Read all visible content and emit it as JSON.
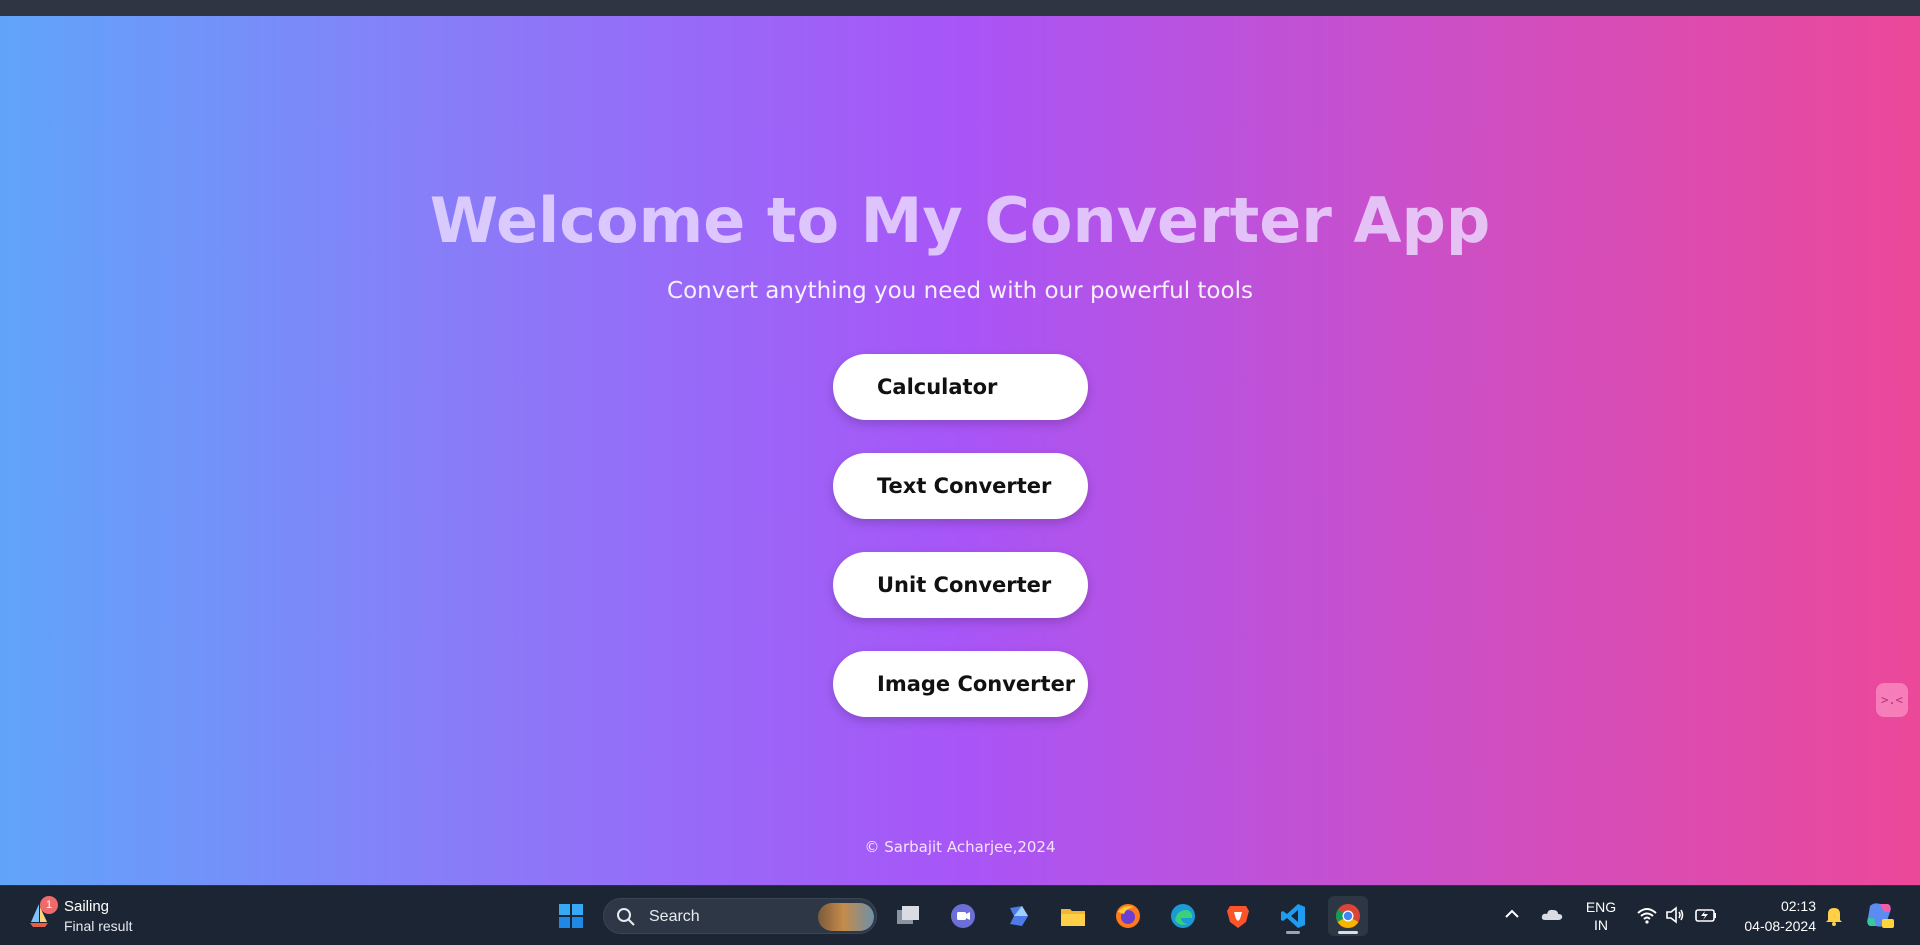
{
  "page": {
    "title": "Welcome to My Converter App",
    "subtitle": "Convert anything you need with our powerful tools",
    "buttons": [
      {
        "label": "Calculator"
      },
      {
        "label": "Text Converter"
      },
      {
        "label": "Unit Converter"
      },
      {
        "label": "Image Converter"
      }
    ],
    "footer": "© Sarbajit Acharjee,2024",
    "widget_glyph": ">.<",
    "gradient_colors": [
      "#60a5fa",
      "#a855f7",
      "#ec4899"
    ]
  },
  "taskbar": {
    "weather": {
      "badge": "1",
      "title": "Sailing",
      "subtitle": "Final result"
    },
    "search": {
      "label": "Search"
    },
    "apps": [
      {
        "icon": "windows-start-icon"
      },
      {
        "icon": "task-view-icon"
      },
      {
        "icon": "meet-video-icon"
      },
      {
        "icon": "copilot-app-icon"
      },
      {
        "icon": "file-explorer-icon"
      },
      {
        "icon": "firefox-icon"
      },
      {
        "icon": "edge-icon"
      },
      {
        "icon": "brave-icon"
      },
      {
        "icon": "vscode-icon"
      },
      {
        "icon": "chrome-icon"
      }
    ],
    "tray": {
      "lang_line1": "ENG",
      "lang_line2": "IN",
      "time": "02:13",
      "date": "04-08-2024"
    }
  }
}
